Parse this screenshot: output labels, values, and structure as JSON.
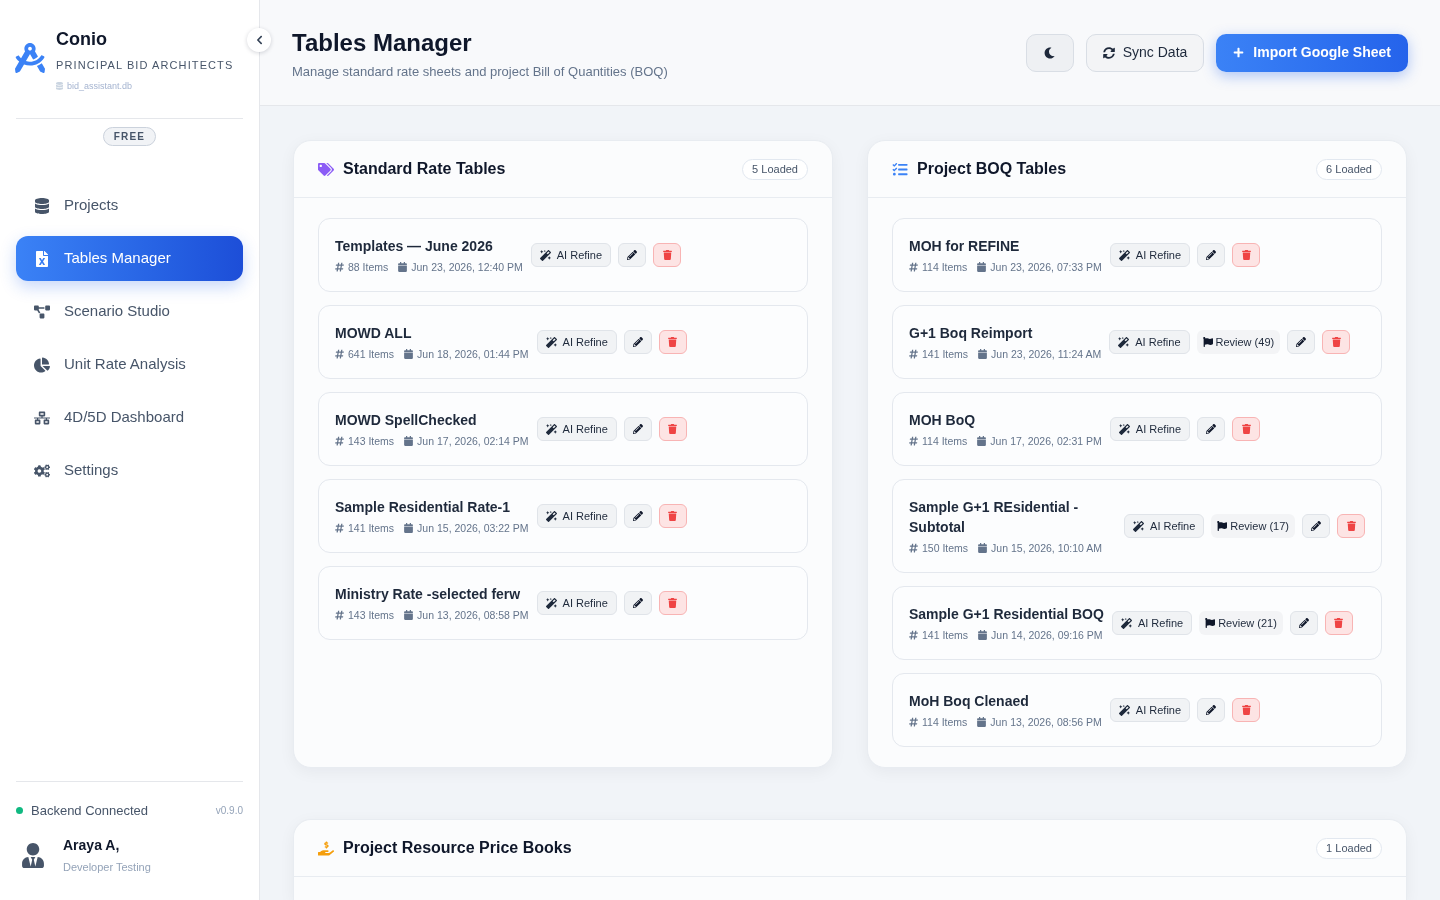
{
  "sidebar": {
    "brand": {
      "name": "Conio",
      "tagline": "PRINCIPAL BID ARCHITECTS",
      "database": "bid_assistant.db"
    },
    "plan_badge": "FREE",
    "nav_items": [
      {
        "label": "Projects",
        "selected": false
      },
      {
        "label": "Tables Manager",
        "selected": true
      },
      {
        "label": "Scenario Studio",
        "selected": false
      },
      {
        "label": "Unit Rate Analysis",
        "selected": false
      },
      {
        "label": "4D/5D Dashboard",
        "selected": false
      },
      {
        "label": "Settings",
        "selected": false
      }
    ],
    "status": {
      "label": "Backend Connected",
      "connected": true,
      "version": "v0.9.0"
    },
    "user": {
      "name": "Araya A,",
      "role": "Developer Testing"
    }
  },
  "header": {
    "title": "Tables Manager",
    "subtitle": "Manage standard rate sheets and project Bill of Quantities (BOQ)",
    "buttons": [
      {
        "kind": "theme"
      },
      {
        "kind": "sync",
        "label": "Sync Data"
      },
      {
        "kind": "import",
        "label": "Import Google Sheet"
      }
    ]
  },
  "panels": [
    {
      "title": "Standard Rate Tables",
      "badge": "5 Loaded",
      "tables": [
        {
          "name": "Templates — June 2026",
          "items": "88 Items",
          "date": "Jun 23, 2026, 12:40 PM",
          "refine": "AI Refine"
        },
        {
          "name": "MOWD ALL",
          "items": "641 Items",
          "date": "Jun 18, 2026, 01:44 PM",
          "refine": "AI Refine"
        },
        {
          "name": "MOWD SpellChecked",
          "items": "143 Items",
          "date": "Jun 17, 2026, 02:14 PM",
          "refine": "AI Refine"
        },
        {
          "name": "Sample Residential Rate-1",
          "items": "141 Items",
          "date": "Jun 15, 2026, 03:22 PM",
          "refine": "AI Refine"
        },
        {
          "name": "Ministry Rate -selected ferw",
          "items": "143 Items",
          "date": "Jun 13, 2026, 08:58 PM",
          "refine": "AI Refine"
        }
      ]
    },
    {
      "title": "Project BOQ Tables",
      "badge": "6 Loaded",
      "tables": [
        {
          "name": "MOH for REFINE",
          "items": "114 Items",
          "date": "Jun 23, 2026, 07:33 PM",
          "refine": "AI Refine"
        },
        {
          "name": "G+1 Boq Reimport",
          "items": "141 Items",
          "date": "Jun 23, 2026, 11:24 AM",
          "refine": "AI Refine",
          "review": "Review (49)"
        },
        {
          "name": "MOH BoQ",
          "items": "114 Items",
          "date": "Jun 17, 2026, 02:31 PM",
          "refine": "AI Refine"
        },
        {
          "name": "Sample G+1 REsidential - Subtotal",
          "items": "150 Items",
          "date": "Jun 15, 2026, 10:10 AM",
          "refine": "AI Refine",
          "review": "Review (17)"
        },
        {
          "name": "Sample G+1 Residential BOQ",
          "items": "141 Items",
          "date": "Jun 14, 2026, 09:16 PM",
          "refine": "AI Refine",
          "review": "Review (21)"
        },
        {
          "name": "MoH Boq Clenaed",
          "items": "114 Items",
          "date": "Jun 13, 2026, 08:56 PM",
          "refine": "AI Refine"
        }
      ]
    },
    {
      "title": "Project Resource Price Books",
      "badge": "1 Loaded"
    }
  ]
}
